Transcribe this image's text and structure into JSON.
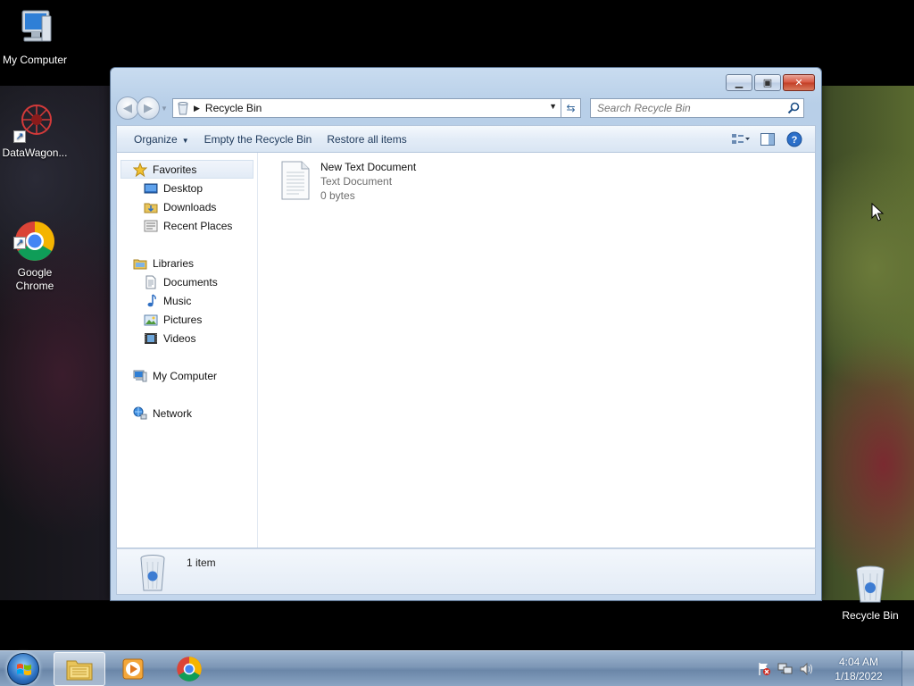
{
  "desktop": {
    "icons": [
      {
        "label": "My Computer"
      },
      {
        "label": "DataWagon..."
      },
      {
        "label": "Google\nChrome"
      },
      {
        "label": "Recycle Bin"
      }
    ]
  },
  "window": {
    "caption_buttons": {
      "minimize": "minimize",
      "maximize": "maximize",
      "close": "close"
    },
    "address": {
      "path": "Recycle Bin"
    },
    "search": {
      "placeholder": "Search Recycle Bin"
    },
    "commands": {
      "organize": "Organize",
      "empty": "Empty the Recycle Bin",
      "restore": "Restore all items"
    },
    "navpane": {
      "favorites": "Favorites",
      "favorites_items": [
        "Desktop",
        "Downloads",
        "Recent Places"
      ],
      "libraries": "Libraries",
      "libraries_items": [
        "Documents",
        "Music",
        "Pictures",
        "Videos"
      ],
      "computer": "My Computer",
      "network": "Network"
    },
    "files": [
      {
        "name": "New Text Document",
        "type": "Text Document",
        "size": "0 bytes"
      }
    ],
    "details": {
      "count": "1 item"
    }
  },
  "taskbar": {
    "clock_time": "4:04 AM",
    "clock_date": "1/18/2022",
    "pinned": [
      "windows-explorer-icon",
      "media-player-icon",
      "chrome-icon"
    ]
  },
  "colors": {
    "window_frame": "#c3d6ec",
    "command_text": "#1e395b",
    "taskbar": "#7d97b6"
  }
}
